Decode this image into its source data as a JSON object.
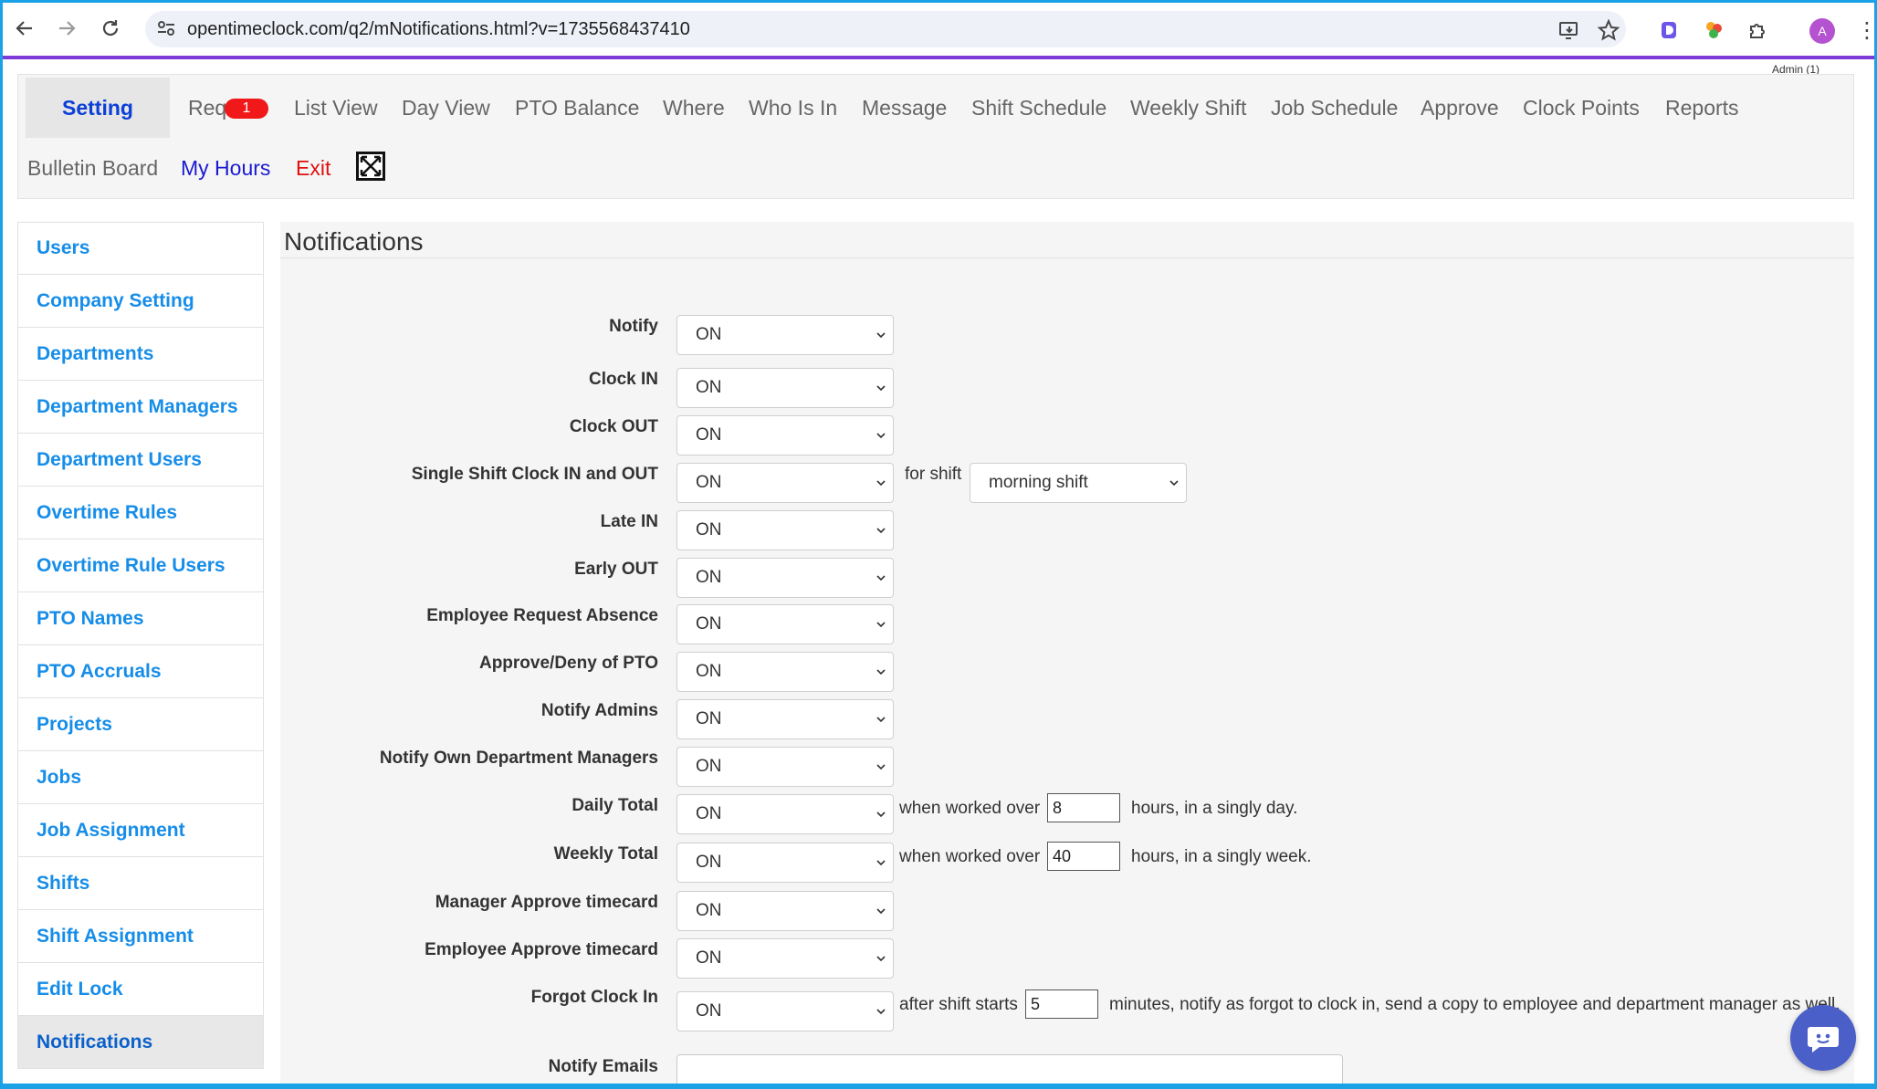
{
  "browser": {
    "url": "opentimeclock.com/q2/mNotifications.html?v=1735568437410",
    "avatar_letter": "A"
  },
  "header": {
    "admin_label": "Admin (1)"
  },
  "topnav": {
    "setting": "Setting",
    "requests": "Req",
    "requests_badge": "1",
    "items": [
      "List View",
      "Day View",
      "PTO Balance",
      "Where",
      "Who Is In",
      "Message",
      "Shift Schedule",
      "Weekly Shift",
      "Job Schedule",
      "Approve",
      "Clock Points",
      "Reports"
    ],
    "bulletin": "Bulletin Board",
    "my_hours": "My Hours",
    "exit": "Exit",
    "colors": {
      "active": "#0b3fd8",
      "my_hours": "#1a1ad0",
      "exit": "#e01010",
      "badge": "#f01818"
    }
  },
  "sidebar": {
    "items": [
      "Users",
      "Company Setting",
      "Departments",
      "Department Managers",
      "Department Users",
      "Overtime Rules",
      "Overtime Rule Users",
      "PTO Names",
      "PTO Accruals",
      "Projects",
      "Jobs",
      "Job Assignment",
      "Shifts",
      "Shift Assignment",
      "Edit Lock",
      "Notifications"
    ],
    "active": "Notifications",
    "link_color": "#168de8"
  },
  "main": {
    "title": "Notifications",
    "rows": [
      {
        "label": "Notify",
        "value": "ON"
      },
      {
        "label": "Clock IN",
        "value": "ON"
      },
      {
        "label": "Clock OUT",
        "value": "ON"
      },
      {
        "label": "Single Shift Clock IN and OUT",
        "value": "ON"
      },
      {
        "label": "Late IN",
        "value": "ON"
      },
      {
        "label": "Early OUT",
        "value": "ON"
      },
      {
        "label": "Employee Request Absence",
        "value": "ON"
      },
      {
        "label": "Approve/Deny of PTO",
        "value": "ON"
      },
      {
        "label": "Notify Admins",
        "value": "ON"
      },
      {
        "label": "Notify Own Department Managers",
        "value": "ON"
      },
      {
        "label": "Daily Total",
        "value": "ON"
      },
      {
        "label": "Weekly Total",
        "value": "ON"
      },
      {
        "label": "Manager Approve timecard",
        "value": "ON"
      },
      {
        "label": "Employee Approve timecard",
        "value": "ON"
      },
      {
        "label": "Forgot Clock In",
        "value": "ON"
      }
    ],
    "for_shift_text": "for shift",
    "shift_value": "morning shift",
    "daily": {
      "prefix": "when worked over",
      "value": "8",
      "suffix": "hours, in a singly day."
    },
    "weekly": {
      "prefix": "when worked over",
      "value": "40",
      "suffix": "hours, in a singly week."
    },
    "forgot": {
      "prefix": "after shift starts",
      "value": "5",
      "suffix": "minutes, notify as forgot to clock in, send a copy to employee and department manager as well."
    },
    "notify_emails_label": "Notify Emails",
    "notify_emails_value": ""
  }
}
